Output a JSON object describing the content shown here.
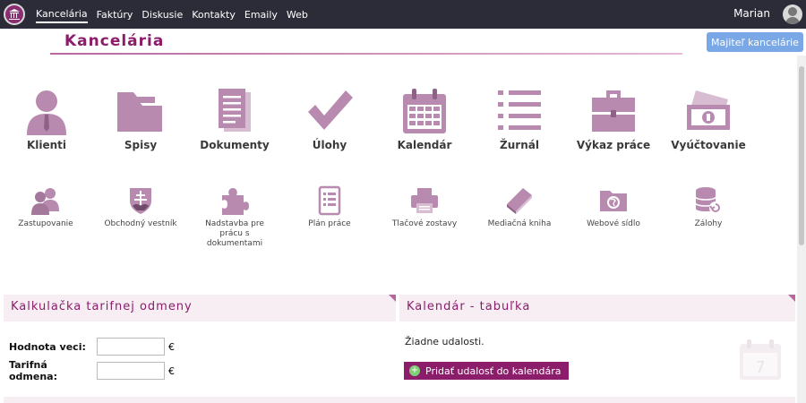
{
  "topbar": {
    "nav": [
      "Kancelária",
      "Faktúry",
      "Diskusie",
      "Kontakty",
      "Emaily",
      "Web"
    ],
    "user": "Marian"
  },
  "page": {
    "title": "Kancelária",
    "owner_button": "Majiteľ kancelárie"
  },
  "modules_big": [
    {
      "label": "Klienti",
      "icon": "user-icon"
    },
    {
      "label": "Spisy",
      "icon": "folder-icon"
    },
    {
      "label": "Dokumenty",
      "icon": "document-icon"
    },
    {
      "label": "Úlohy",
      "icon": "check-icon"
    },
    {
      "label": "Kalendár",
      "icon": "calendar-icon"
    },
    {
      "label": "Žurnál",
      "icon": "list-icon"
    },
    {
      "label": "Výkaz práce",
      "icon": "briefcase-icon"
    },
    {
      "label": "Vyúčtovanie",
      "icon": "money-icon"
    }
  ],
  "modules_small": [
    {
      "label": "Zastupovanie",
      "icon": "users-icon"
    },
    {
      "label": "Obchodný vestník",
      "icon": "coat-of-arms-icon"
    },
    {
      "label": "Nadstavba pre prácu s dokumentami",
      "icon": "puzzle-icon"
    },
    {
      "label": "Plán práce",
      "icon": "checklist-icon"
    },
    {
      "label": "Tlačové zostavy",
      "icon": "printer-icon"
    },
    {
      "label": "Mediačná kniha",
      "icon": "book-icon"
    },
    {
      "label": "Webové sídlo",
      "icon": "web-folder-icon"
    },
    {
      "label": "Zálohy",
      "icon": "database-icon"
    }
  ],
  "calculator": {
    "title": "Kalkulačka tarifnej odmeny",
    "value_label": "Hodnota veci:",
    "fee_label": "Tarifná odmena:",
    "currency": "€",
    "value": "",
    "fee": ""
  },
  "calendar_panel": {
    "title": "Kalendár - tabuľka",
    "empty_text": "Žiadne udalosti.",
    "add_button": "Pridať udalosť do kalendára",
    "watermark_day": "7"
  },
  "colors": {
    "accent": "#8b1d6a",
    "icon": "#b98ab0",
    "topbar": "#2c2c38",
    "button_blue": "#7aa8e6"
  }
}
